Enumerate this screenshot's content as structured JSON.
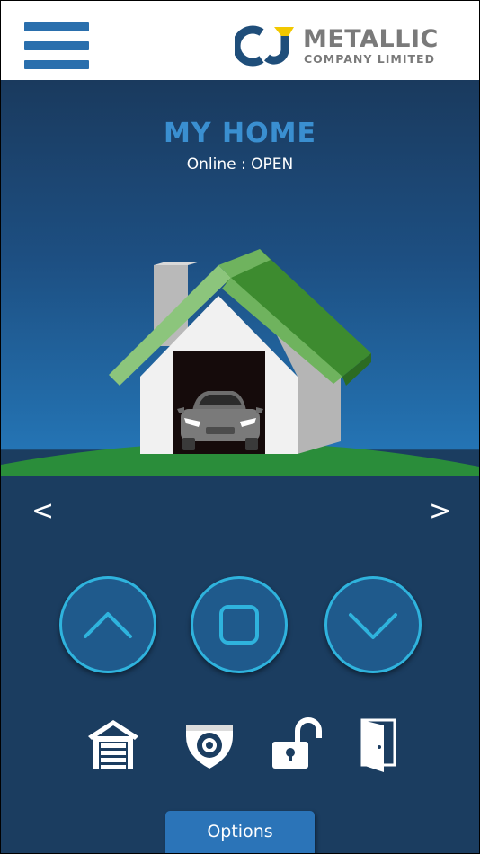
{
  "header": {
    "logo_line1": "METALLIC",
    "logo_line2": "COMPANY LIMITED",
    "logo_monogram": "CJ"
  },
  "home": {
    "title": "MY HOME",
    "status": "Online : OPEN"
  },
  "nav": {
    "prev": "<",
    "next": ">"
  },
  "controls": {
    "up_icon": "chevron-up-icon",
    "stop_icon": "stop-square-icon",
    "down_icon": "chevron-down-icon"
  },
  "toolbar": {
    "icons": [
      "garage-icon",
      "camera-icon",
      "unlock-icon",
      "door-icon"
    ],
    "options_label": "Options"
  },
  "colors": {
    "accent": "#3a8fd0",
    "button_ring": "#2fb3dd",
    "background": "#1b3d60",
    "roof_green": "#3d8b2f"
  }
}
